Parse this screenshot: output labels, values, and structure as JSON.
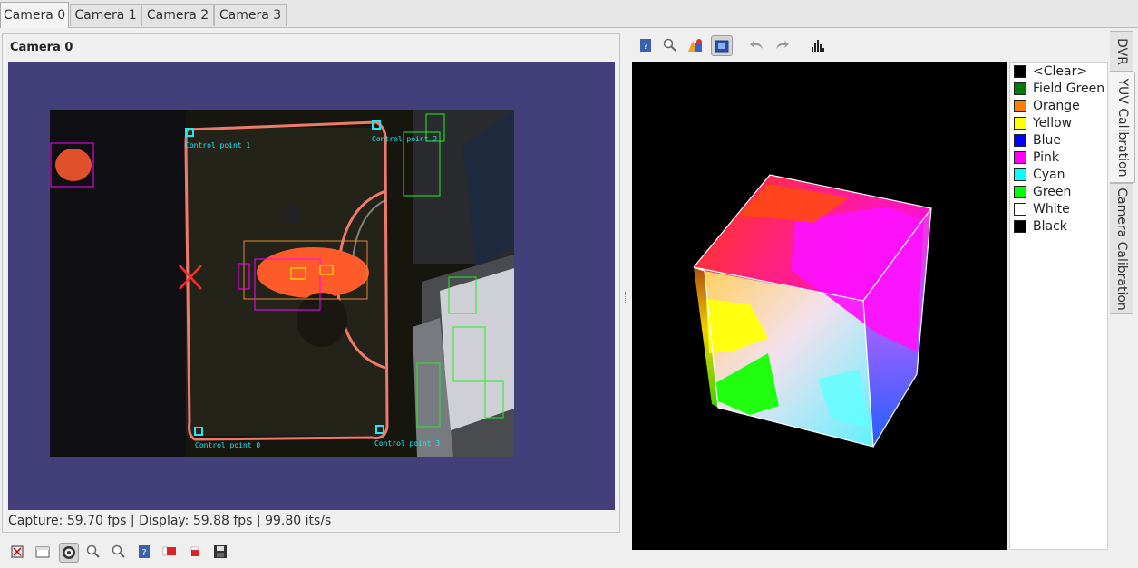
{
  "tabs": [
    {
      "label": "Camera 0",
      "active": true
    },
    {
      "label": "Camera 1",
      "active": false
    },
    {
      "label": "Camera 2",
      "active": false
    },
    {
      "label": "Camera 3",
      "active": false
    }
  ],
  "camera_panel": {
    "title": "Camera 0",
    "status": "Capture: 59.70 fps | Display: 59.88 fps | 99.80 its/s",
    "overlay_labels": {
      "cp1": "Control point 1",
      "cp2": "Control point 2",
      "cp0": "Control point 0",
      "cp3": "Control point 3"
    },
    "toolbar_icons": [
      "fit-icon",
      "open-file-icon",
      "record-target-icon",
      "zoom-in-icon",
      "zoom-out-icon",
      "help-icon",
      "flag-red-icon",
      "flag-small-icon",
      "save-icon"
    ]
  },
  "right_toolbar_icons": [
    "help-icon",
    "zoom-icon",
    "shapes-icon",
    "display-icon",
    "undo-icon",
    "redo-icon",
    "histogram-icon"
  ],
  "color_classes": [
    {
      "label": "<Clear>",
      "color": "#000000"
    },
    {
      "label": "Field Green",
      "color": "#007a00"
    },
    {
      "label": "Orange",
      "color": "#ff8000"
    },
    {
      "label": "Yellow",
      "color": "#ffff00"
    },
    {
      "label": "Blue",
      "color": "#0000ff"
    },
    {
      "label": "Pink",
      "color": "#ff00ff"
    },
    {
      "label": "Cyan",
      "color": "#00ffff"
    },
    {
      "label": "Green",
      "color": "#00ff00"
    },
    {
      "label": "White",
      "color": "#ffffff"
    },
    {
      "label": "Black",
      "color": "#000000"
    }
  ],
  "side_tabs": [
    {
      "label": "DVR",
      "active": false
    },
    {
      "label": "YUV Calibration",
      "active": true
    },
    {
      "label": "Camera Calibration",
      "active": false
    }
  ]
}
